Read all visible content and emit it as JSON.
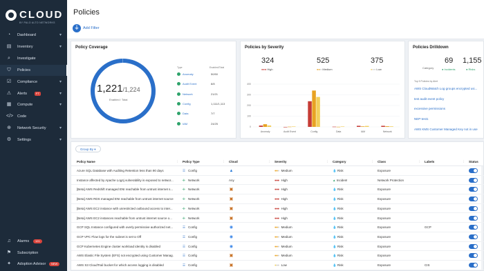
{
  "logo": {
    "name": "CLOUD",
    "sub": "BY PALO ALTO NETWORKS"
  },
  "sidebar": {
    "items": [
      {
        "label": "Dashboard",
        "icon": "dashboard-icon",
        "glyph": "◔",
        "chevron": true
      },
      {
        "label": "Inventory",
        "icon": "inventory-icon",
        "glyph": "▤",
        "chevron": true
      },
      {
        "label": "Investigate",
        "icon": "search-icon",
        "glyph": "⌕",
        "chevron": false
      },
      {
        "label": "Policies",
        "icon": "shield-icon",
        "glyph": "⛉",
        "chevron": false,
        "active": true
      },
      {
        "label": "Compliance",
        "icon": "compliance-icon",
        "glyph": "☑",
        "chevron": true
      },
      {
        "label": "Alerts",
        "icon": "bell-icon",
        "glyph": "⚠",
        "chevron": true,
        "badge": "FT"
      },
      {
        "label": "Compute",
        "icon": "compute-icon",
        "glyph": "▦",
        "chevron": true
      },
      {
        "label": "Code",
        "icon": "code-icon",
        "glyph": "</>",
        "chevron": false
      },
      {
        "label": "Network Security",
        "icon": "network-icon",
        "glyph": "⊕",
        "chevron": true
      },
      {
        "label": "Settings",
        "icon": "gear-icon",
        "glyph": "⚙",
        "chevron": true
      }
    ],
    "bottom": [
      {
        "label": "Alarms",
        "icon": "alarm-icon",
        "glyph": "♫",
        "badge": "121"
      },
      {
        "label": "Subscription",
        "icon": "subscription-icon",
        "glyph": "⚑"
      },
      {
        "label": "Adoption Advisor",
        "icon": "advisor-icon",
        "glyph": "✦",
        "badge": "NEW"
      }
    ]
  },
  "header": {
    "title": "Policies",
    "add_filter": "Add Filter"
  },
  "coverage": {
    "title": "Policy Coverage",
    "enabled": "1,221",
    "total": "/1,224",
    "subtitle": "Enabled / Total",
    "percent_enabled": 0.997,
    "col_type": "Type",
    "col_enabled": "Enabled/Total",
    "rows": [
      {
        "type": "Anomaly",
        "value": "50/50"
      },
      {
        "type": "Audit Event",
        "value": "8/8"
      },
      {
        "type": "Network",
        "value": "21/21"
      },
      {
        "type": "Config",
        "value": "1,111/1,113"
      },
      {
        "type": "Data",
        "value": "7/7"
      },
      {
        "type": "IAM",
        "value": "24/25"
      }
    ]
  },
  "severity": {
    "title": "Policies by Severity",
    "high": {
      "count": "324",
      "label": "High"
    },
    "medium": {
      "count": "525",
      "label": "Medium"
    },
    "low": {
      "count": "375",
      "label": "Low"
    },
    "colors": {
      "high": "#c63c35",
      "medium": "#e8a323",
      "low": "#f2cf5b"
    }
  },
  "chart_data": {
    "type": "bar",
    "categories": [
      "Anomaly",
      "Audit Event",
      "Config",
      "Data",
      "IAM",
      "Network"
    ],
    "series": [
      {
        "name": "High",
        "values": [
          12,
          0,
          240,
          2,
          10,
          10
        ]
      },
      {
        "name": "Medium",
        "values": [
          25,
          2,
          340,
          1,
          5,
          6
        ]
      },
      {
        "name": "Low",
        "values": [
          13,
          4,
          280,
          4,
          9,
          5
        ]
      }
    ],
    "yticks": [
      "0",
      "100",
      "200",
      "300",
      "400"
    ],
    "ylim": [
      0,
      400
    ]
  },
  "drilldown": {
    "title": "Policies Drilldown",
    "category_label": "Category",
    "incidents": {
      "count": "69",
      "label": "Incidents"
    },
    "risks": {
      "count": "1,155",
      "label": "Risks"
    },
    "sub": "Top 5 Policies by Alert",
    "links": [
      "AWS CloudWatch Log groups encrypted usi...",
      "test audit event policy",
      "excessive permissions",
      "NEP-test1",
      "AWS KMS Customer Managed Key not in use"
    ]
  },
  "table": {
    "group_by": "Group By",
    "headers": [
      "Policy Name",
      "Policy Type",
      "Cloud",
      "Severity",
      "Category",
      "Class",
      "Labels",
      "Status"
    ],
    "rows": [
      {
        "name": "Azure SQL Database with Auditing Retention less than 90 days",
        "type": "Config",
        "cloud": "azure",
        "severity": "Medium",
        "category": "Risk",
        "class": "Exposure",
        "labels": ""
      },
      {
        "name": "Instance affected by Apache Log4j vulnerability is exposed to networ...",
        "type": "Network",
        "cloud": "Any",
        "severity": "High",
        "category": "Incident",
        "class": "Network Protection",
        "labels": ""
      },
      {
        "name": "[Beta] AWS Redshift managed ENI reachable from untrust internet s...",
        "type": "Network",
        "cloud": "aws",
        "severity": "High",
        "category": "Risk",
        "class": "Exposure",
        "labels": ""
      },
      {
        "name": "[Beta] AWS RDS managed ENI reachable from untrust internet source",
        "type": "Network",
        "cloud": "aws",
        "severity": "High",
        "category": "Risk",
        "class": "Exposure",
        "labels": ""
      },
      {
        "name": "[Beta] AWS EC2 instance with unrestricted outbound access to inter...",
        "type": "Network",
        "cloud": "aws",
        "severity": "High",
        "category": "Risk",
        "class": "Exposure",
        "labels": ""
      },
      {
        "name": "[Beta] AWS EC2 instances reachable from untrust internet source o...",
        "type": "Network",
        "cloud": "aws",
        "severity": "High",
        "category": "Risk",
        "class": "Exposure",
        "labels": ""
      },
      {
        "name": "GCP SQL Instance configured with overly permissive authorized net...",
        "type": "Config",
        "cloud": "gcp",
        "severity": "Medium",
        "category": "Risk",
        "class": "Exposure",
        "labels": "GCP"
      },
      {
        "name": "GCP VPC Flow logs for the subnet is set to Off",
        "type": "Config",
        "cloud": "gcp",
        "severity": "Medium",
        "category": "Risk",
        "class": "Exposure",
        "labels": ""
      },
      {
        "name": "GCP Kubernetes Engine cluster workload identity is disabled",
        "type": "Config",
        "cloud": "gcp",
        "severity": "Medium",
        "category": "Risk",
        "class": "Exposure",
        "labels": ""
      },
      {
        "name": "AWS Elastic File System (EFS) not encrypted using Customer Manag...",
        "type": "Config",
        "cloud": "aws",
        "severity": "Medium",
        "category": "Risk",
        "class": "Exposure",
        "labels": ""
      },
      {
        "name": "AWS S3 CloudTrail bucket for which access logging is disabled",
        "type": "Config",
        "cloud": "aws",
        "severity": "Low",
        "category": "Risk",
        "class": "Exposure",
        "labels": "CIS"
      }
    ]
  }
}
